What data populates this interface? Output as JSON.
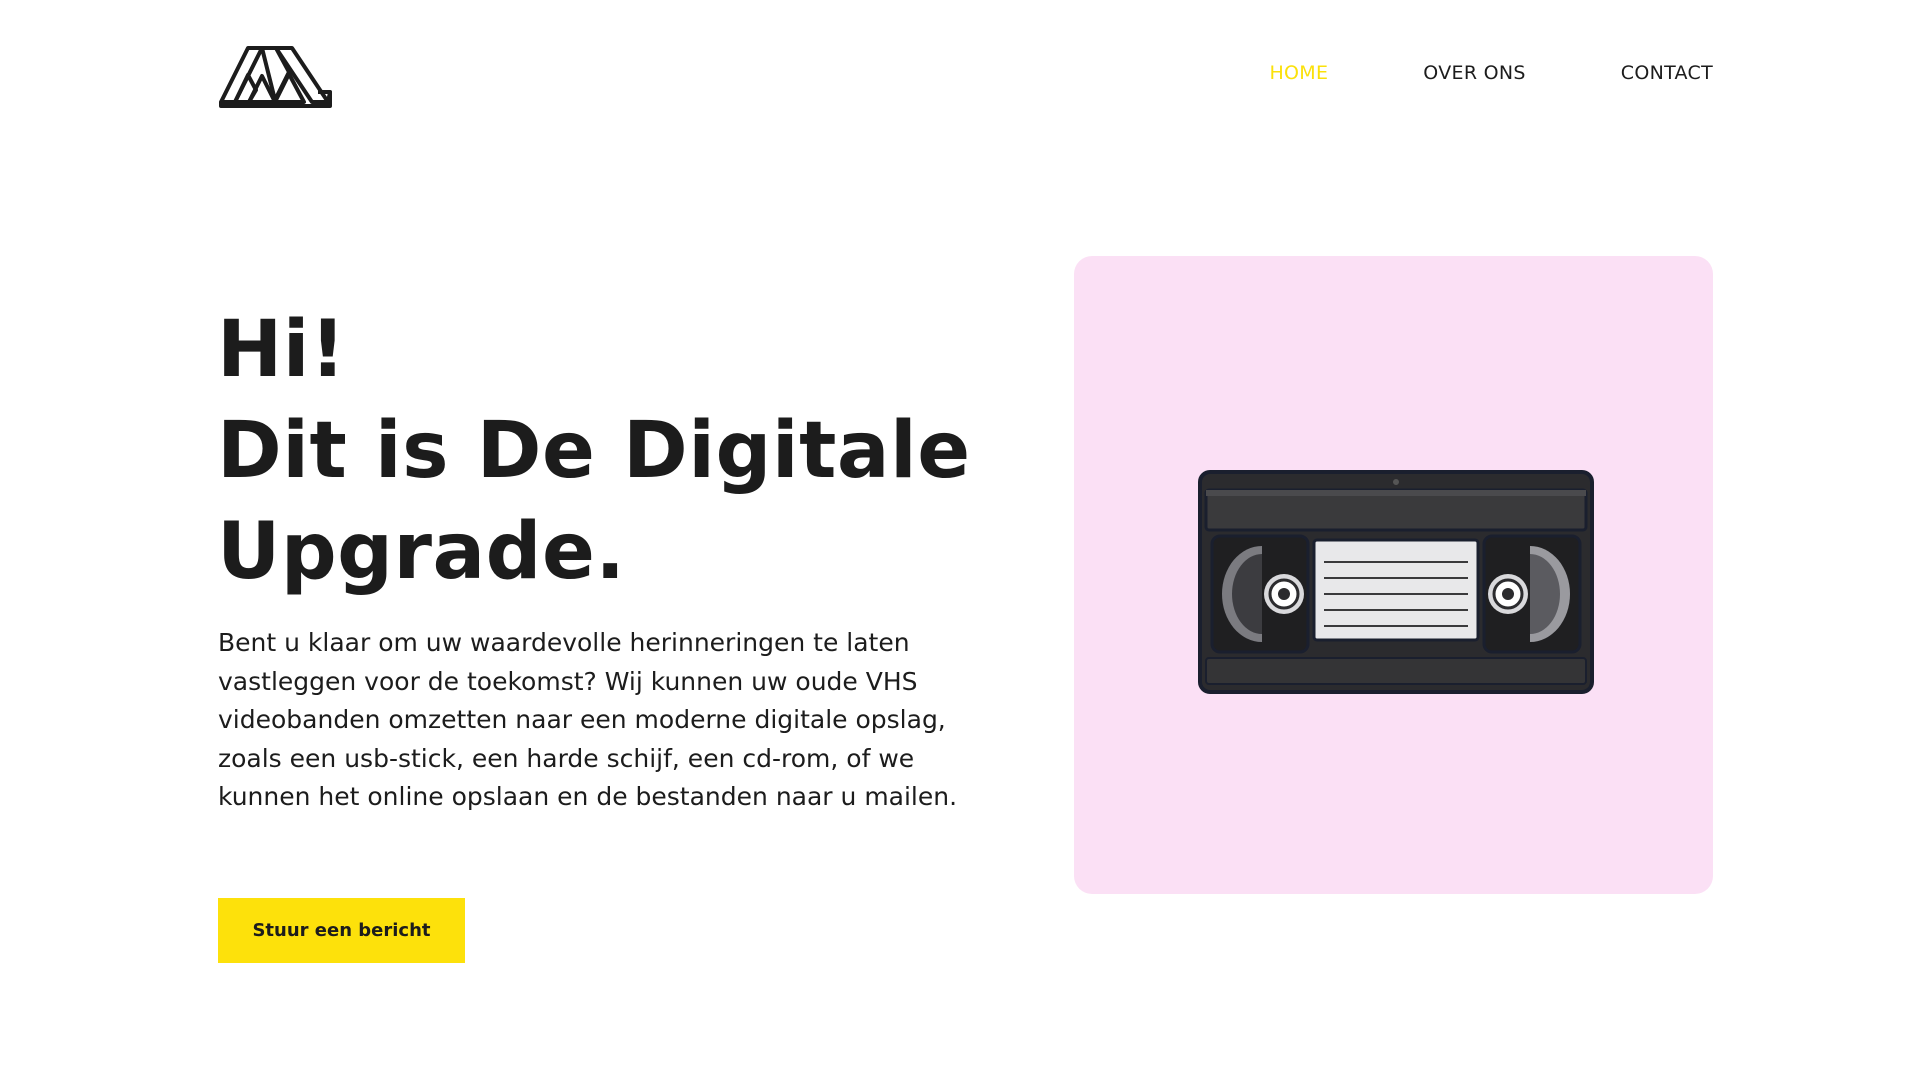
{
  "header": {
    "logo_icon": "mountain-m-logo",
    "nav": [
      {
        "label": "HOME",
        "active": true
      },
      {
        "label": "OVER ONS",
        "active": false
      },
      {
        "label": "CONTACT",
        "active": false
      }
    ]
  },
  "hero": {
    "title_lines": [
      "Hi!",
      "Dit is De Digitale",
      "Upgrade."
    ],
    "description": "Bent u klaar om uw waardevolle herinneringen te laten vastleggen voor de toekomst? Wij kunnen uw oude VHS videobanden omzetten naar een moderne digitale opslag, zoals een usb-stick, een harde schijf, een cd-rom, of we kunnen het online opslaan en de bestanden naar u mailen.",
    "cta_label": "Stuur een bericht"
  },
  "media": {
    "illustration_icon": "vhs-cassette-icon"
  },
  "colors": {
    "accent": "#fde10b",
    "card_background": "#fbe0f5",
    "text": "#1c1c1c"
  }
}
